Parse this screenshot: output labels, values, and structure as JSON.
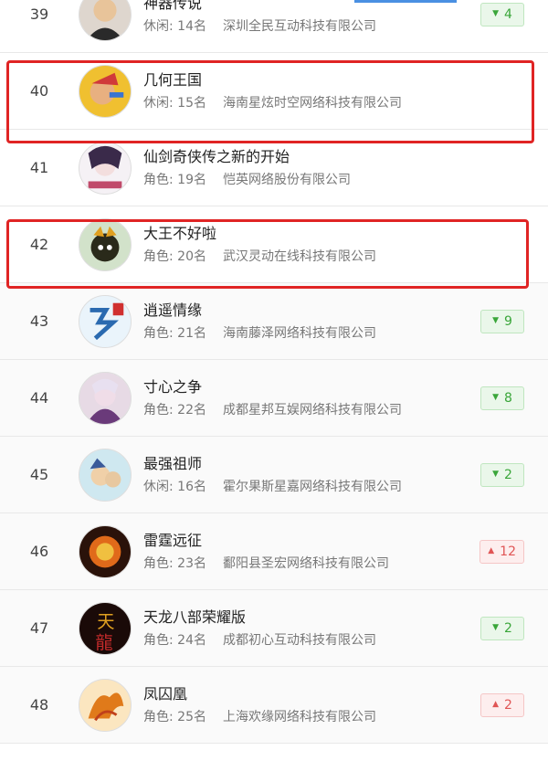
{
  "rows": [
    {
      "rank": "39",
      "title": "神器传说",
      "category": "休闲: 14名",
      "company": "深圳全民互动科技有限公司",
      "change": "4",
      "direction": "down",
      "avatar_color": "#7a5a3a"
    },
    {
      "rank": "40",
      "title": "几何王国",
      "category": "休闲: 15名",
      "company": "海南星炫时空网络科技有限公司",
      "change": "",
      "direction": "",
      "avatar_color": "#3a74d0"
    },
    {
      "rank": "41",
      "title": "仙剑奇侠传之新的开始",
      "category": "角色: 19名",
      "company": "恺英网络股份有限公司",
      "change": "",
      "direction": "",
      "avatar_color": "#d9c7d8"
    },
    {
      "rank": "42",
      "title": "大王不好啦",
      "category": "角色: 20名",
      "company": "武汉灵动在线科技有限公司",
      "change": "",
      "direction": "",
      "avatar_color": "#4a8a2a"
    },
    {
      "rank": "43",
      "title": "逍遥情缘",
      "category": "角色: 21名",
      "company": "海南藤泽网络科技有限公司",
      "change": "9",
      "direction": "down",
      "avatar_color": "#5aa0e0"
    },
    {
      "rank": "44",
      "title": "寸心之争",
      "category": "角色: 22名",
      "company": "成都星邦互娱网络科技有限公司",
      "change": "8",
      "direction": "down",
      "avatar_color": "#b07aa8"
    },
    {
      "rank": "45",
      "title": "最强祖师",
      "category": "休闲: 16名",
      "company": "霍尔果斯星嘉网络科技有限公司",
      "change": "2",
      "direction": "down",
      "avatar_color": "#7ab0c0"
    },
    {
      "rank": "46",
      "title": "雷霆远征",
      "category": "角色: 23名",
      "company": "鄱阳县圣宏网络科技有限公司",
      "change": "12",
      "direction": "up",
      "avatar_color": "#b04a1a"
    },
    {
      "rank": "47",
      "title": "天龙八部荣耀版",
      "category": "角色: 24名",
      "company": "成都初心互动科技有限公司",
      "change": "2",
      "direction": "down",
      "avatar_color": "#3a1a12"
    },
    {
      "rank": "48",
      "title": "凤囚凰",
      "category": "角色: 25名",
      "company": "上海欢缘网络科技有限公司",
      "change": "2",
      "direction": "up",
      "avatar_color": "#e0902a"
    }
  ],
  "colors": {
    "highlight": "#e02424",
    "down": "#3aa63a",
    "up": "#e05555",
    "tab_accent": "#4a90e2"
  }
}
